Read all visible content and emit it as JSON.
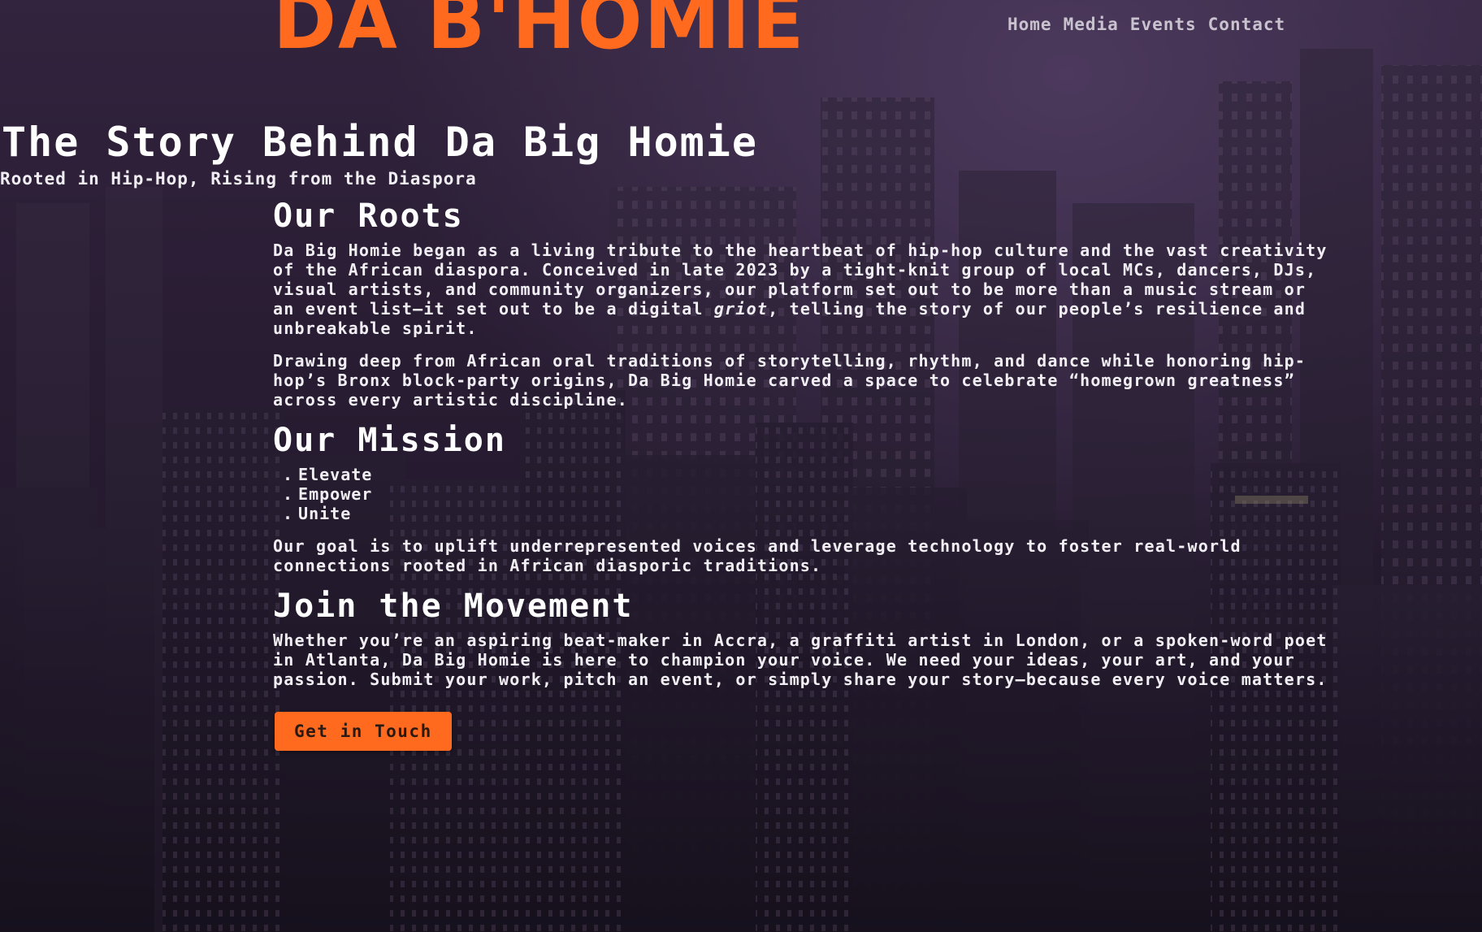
{
  "brand": {
    "logo_text": "DA B'HOMIE",
    "accent_color": "#ff6a1f"
  },
  "nav": {
    "items": [
      {
        "label": "Home"
      },
      {
        "label": "Media"
      },
      {
        "label": "Events"
      },
      {
        "label": "Contact"
      }
    ]
  },
  "hero": {
    "title": "The Story Behind Da Big Homie",
    "subtitle": "Rooted in Hip-Hop, Rising from the Diaspora"
  },
  "roots": {
    "heading": "Our Roots",
    "p1_before": "Da Big Homie began as a living tribute to the heartbeat of hip-hop culture and the vast creativity of the African diaspora. Conceived in late 2023 by a tight-knit group of local MCs, dancers, DJs, visual artists, and community organizers, our platform set out to be more than a music stream or an event list—it set out to be a digital ",
    "p1_em": "griot",
    "p1_after": ", telling the story of our people’s resilience and unbreakable spirit.",
    "p2": "Drawing deep from African oral traditions of storytelling, rhythm, and dance while honoring hip-hop’s Bronx block-party origins, Da Big Homie carved a space to celebrate “homegrown greatness” across every artistic discipline."
  },
  "mission": {
    "heading": "Our Mission",
    "items": [
      "Elevate",
      "Empower",
      "Unite"
    ],
    "goal": "Our goal is to uplift underrepresented voices and leverage technology to foster real-world connections rooted in African diasporic traditions."
  },
  "movement": {
    "heading": "Join the Movement",
    "body": "Whether you’re an aspiring beat-maker in Accra, a graffiti artist in London, or a spoken-word poet in Atlanta, Da Big Homie is here to champion your voice. We need your ideas, your art, and your passion. Submit your work, pitch an event, or simply share your story—because every voice matters.",
    "cta_label": "Get in Touch"
  }
}
